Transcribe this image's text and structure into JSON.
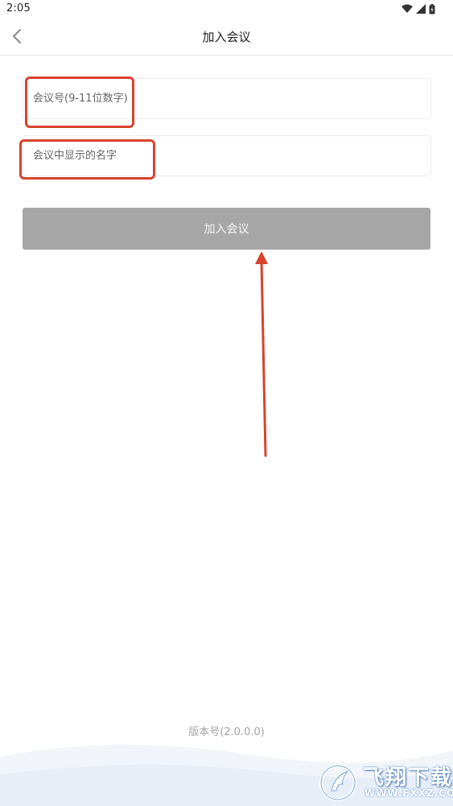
{
  "status_bar": {
    "time": "2:05",
    "icons": [
      "wifi-icon",
      "cellular-signal-icon",
      "battery-icon"
    ]
  },
  "header": {
    "title": "加入会议",
    "back_icon": "chevron-left-icon"
  },
  "form": {
    "meeting_number": {
      "value": "",
      "placeholder": "会议号(9-11位数字)"
    },
    "display_name": {
      "value": "",
      "placeholder": "会议中显示的名字"
    },
    "join_button_label": "加入会议"
  },
  "footer": {
    "version": "版本号(2.0.0.0)"
  },
  "watermark": {
    "title": "飞翔下载",
    "domain": "WWW.FXXZ.COM"
  },
  "colors": {
    "annotation": "#d8432c",
    "button_disabled": "#a6a6a6",
    "wave_light": "#e8eef7"
  }
}
